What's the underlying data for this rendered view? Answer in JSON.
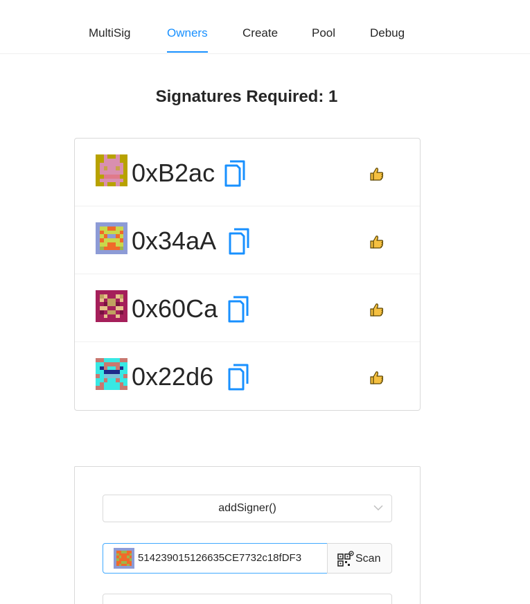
{
  "nav": {
    "tabs": [
      {
        "label": "MultiSig"
      },
      {
        "label": "Owners",
        "active": true
      },
      {
        "label": "Create"
      },
      {
        "label": "Pool"
      },
      {
        "label": "Debug"
      }
    ],
    "accent_color": "#1890ff"
  },
  "signatures": {
    "title": "Signatures Required: 1"
  },
  "owners": [
    {
      "address": "0xB2ac",
      "icon": "copy-icon",
      "action_icon": "thumbs-up-icon"
    },
    {
      "address": "0x34aA",
      "icon": "copy-icon",
      "action_icon": "thumbs-up-icon"
    },
    {
      "address": "0x60Ca",
      "icon": "copy-icon",
      "action_icon": "thumbs-up-icon"
    },
    {
      "address": "0x22d6",
      "icon": "copy-icon",
      "action_icon": "thumbs-up-icon"
    }
  ],
  "form": {
    "method_select": "addSigner()",
    "address_value": "514239015126635CE7732c18fDF3",
    "scan_label": "Scan"
  }
}
